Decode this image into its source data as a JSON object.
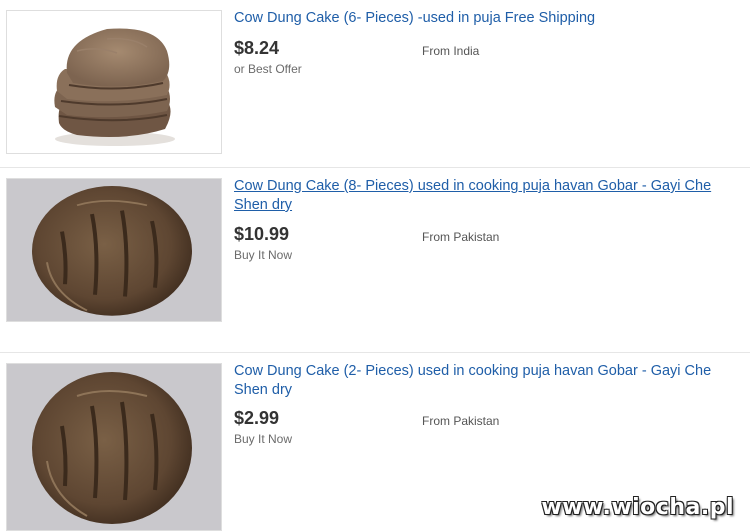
{
  "listings": [
    {
      "title": "Cow Dung Cake (6- Pieces) -used in puja Free Shipping",
      "price": "$8.24",
      "format": "or Best Offer",
      "location": "From India"
    },
    {
      "title": "Cow Dung Cake (8- Pieces) used in cooking puja havan Gobar - Gayi Che Shen dry",
      "price": "$10.99",
      "format": "Buy It Now",
      "location": "From Pakistan"
    },
    {
      "title": "Cow Dung Cake (2- Pieces) used in cooking puja havan Gobar - Gayi Che Shen dry",
      "price": "$2.99",
      "format": "Buy It Now",
      "location": "From Pakistan"
    }
  ],
  "watermark": "www.wiocha.pl",
  "colors": {
    "link": "#1f5ea8",
    "price": "#333333",
    "muted": "#6b6b6b"
  }
}
